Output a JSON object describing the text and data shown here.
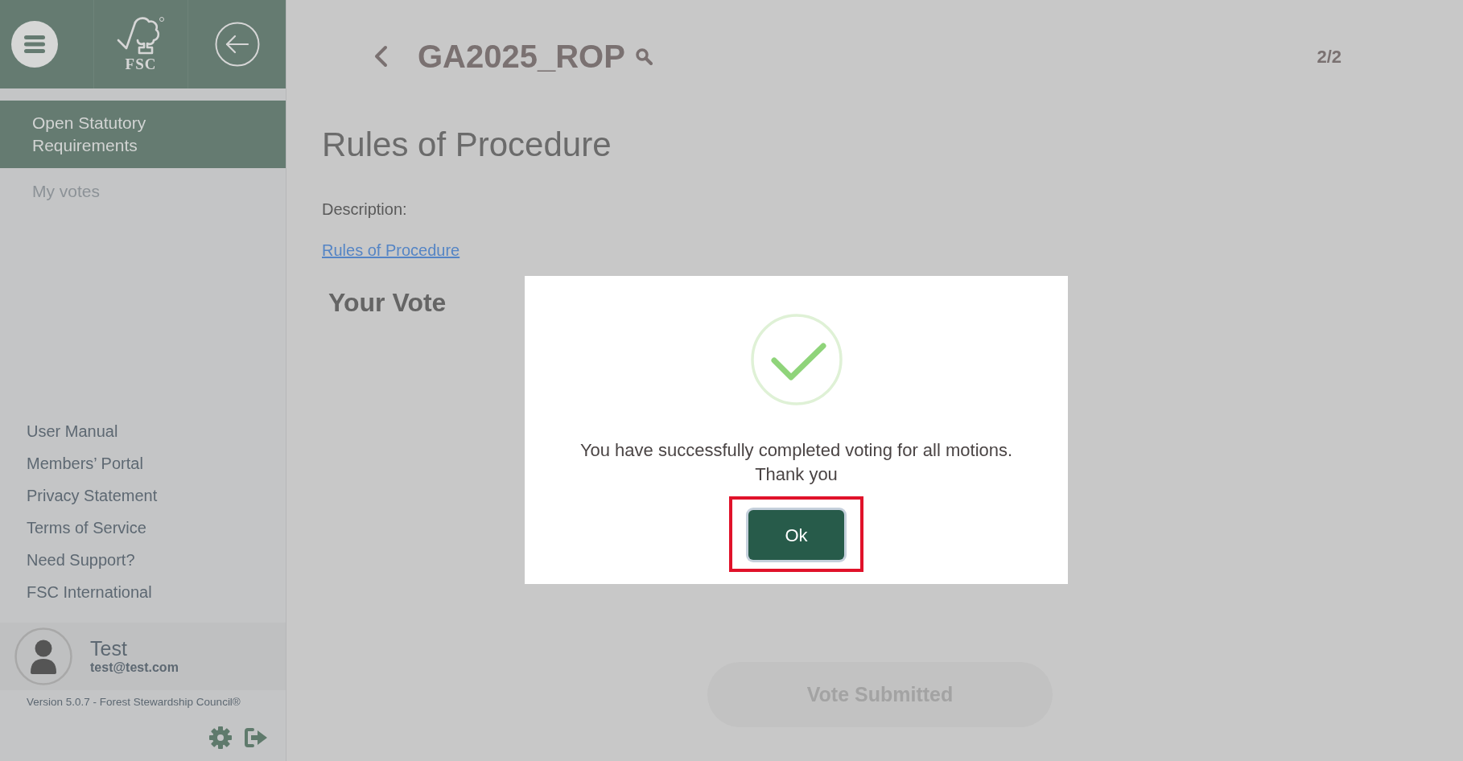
{
  "sidebar": {
    "logo_text": "FSC",
    "nav_items": [
      {
        "label": "Open Statutory Requirements",
        "selected": true
      },
      {
        "label": "My votes",
        "selected": false
      }
    ],
    "links": [
      "User Manual",
      "Members’ Portal",
      "Privacy Statement",
      "Terms of Service",
      "Need Support?",
      "FSC International"
    ],
    "user": {
      "name": "Test",
      "email": "test@test.com"
    },
    "version": "Version 5.0.7 - Forest Stewardship Council®"
  },
  "header": {
    "title": "GA2025_ROP",
    "pager": "2/2"
  },
  "motion": {
    "title": "Rules of Procedure",
    "description_label": "Description:",
    "link": "Rules of Procedure",
    "vote_heading": "Your Vote"
  },
  "submit_button": {
    "label": "Vote Submitted",
    "disabled": true
  },
  "dialog": {
    "message": "You have successfully completed voting for all motions.\nThank you",
    "button": {
      "label": "Ok",
      "highlighted": true
    }
  }
}
